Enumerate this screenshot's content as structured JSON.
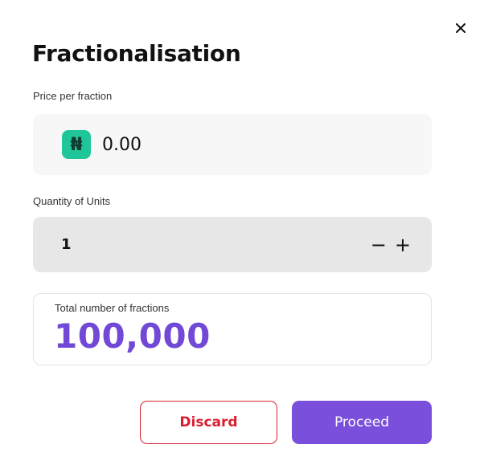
{
  "modal": {
    "title": "Fractionalisation",
    "close_icon": "close-icon"
  },
  "price": {
    "label": "Price per fraction",
    "currency_symbol": "₦",
    "currency_icon": "naira-icon",
    "currency_badge_color": "#1fc69a",
    "value": "0.00"
  },
  "quantity": {
    "label": "Quantity of Units",
    "value": "1",
    "decrement_symbol": "−",
    "increment_symbol": "+"
  },
  "total": {
    "label": "Total number of fractions",
    "value": "100,000",
    "color": "#7149d6"
  },
  "actions": {
    "discard_label": "Discard",
    "discard_color": "#d91f2f",
    "proceed_label": "Proceed",
    "proceed_color": "#7a4fdc"
  }
}
